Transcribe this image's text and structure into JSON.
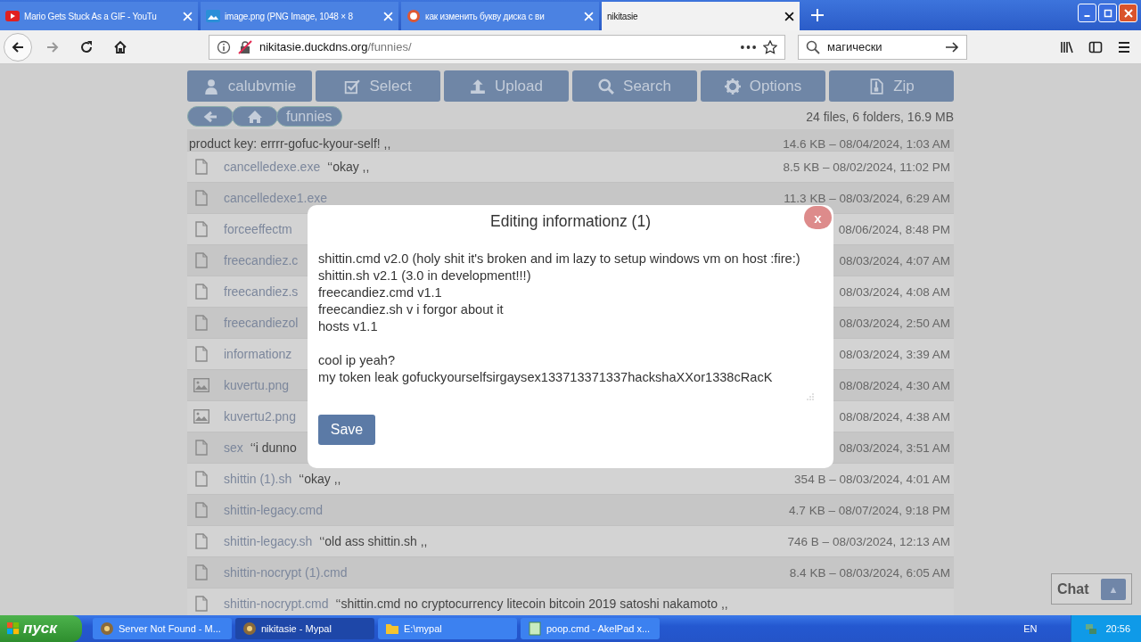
{
  "browser": {
    "tabs": [
      {
        "title": "Mario Gets Stuck As a GIF - YouTu",
        "kind": "video",
        "selected": false
      },
      {
        "title": "image.png (PNG Image, 1048 × 8",
        "kind": "image",
        "selected": false
      },
      {
        "title": "как изменить букву диска с ви",
        "kind": "search",
        "selected": false
      },
      {
        "title": "nikitasie",
        "kind": "plain",
        "selected": true
      }
    ],
    "url_host": "nikitasie.duckdns.org",
    "url_path": "/funnies/",
    "search_value": "магически"
  },
  "toolbar": [
    {
      "label": "calubvmie",
      "kind": "user"
    },
    {
      "label": "Select",
      "kind": "check"
    },
    {
      "label": "Upload",
      "kind": "upload"
    },
    {
      "label": "Search",
      "kind": "search"
    },
    {
      "label": "Options",
      "kind": "gear"
    },
    {
      "label": "Zip",
      "kind": "zip"
    }
  ],
  "breadcrumbs": [
    {
      "kind": "back"
    },
    {
      "kind": "home"
    },
    {
      "kind": "text",
      "label": "funnies"
    }
  ],
  "stats": "24 files, 6 folders, 16.9 MB",
  "files": [
    {
      "kind": "partial",
      "comment": "product key: errrr-gofuc-kyour-self! ,,",
      "meta": "14.6 KB – 08/04/2024, 1:03 AM"
    },
    {
      "kind": "file",
      "name": "cancelledexe.exe",
      "comment": "‘‘okay ,,",
      "meta": "8.5 KB – 08/02/2024, 11:02 PM"
    },
    {
      "kind": "file",
      "name": "cancelledexe1.exe",
      "meta": "11.3 KB – 08/03/2024, 6:29 AM"
    },
    {
      "kind": "file",
      "name": "forceeffectm",
      "meta": "08/06/2024, 8:48 PM"
    },
    {
      "kind": "file",
      "name": "freecandiez.c",
      "meta": "08/03/2024, 4:07 AM"
    },
    {
      "kind": "file",
      "name": "freecandiez.s",
      "meta": "08/03/2024, 4:08 AM"
    },
    {
      "kind": "file",
      "name": "freecandiezol",
      "meta": "08/03/2024, 2:50 AM"
    },
    {
      "kind": "file",
      "name": "informationz",
      "meta": "08/03/2024, 3:39 AM"
    },
    {
      "kind": "image",
      "name": "kuvertu.png",
      "meta": "08/08/2024, 4:30 AM"
    },
    {
      "kind": "image",
      "name": "kuvertu2.png",
      "meta": "08/08/2024, 4:38 AM"
    },
    {
      "kind": "file",
      "name": "sex",
      "comment": "‘‘i dunno",
      "meta": "08/03/2024, 3:51 AM"
    },
    {
      "kind": "file",
      "name": "shittin (1).sh",
      "comment": "‘‘okay ,,",
      "meta": "354 B – 08/03/2024, 4:01 AM"
    },
    {
      "kind": "file",
      "name": "shittin-legacy.cmd",
      "meta": "4.7 KB – 08/07/2024, 9:18 PM"
    },
    {
      "kind": "file",
      "name": "shittin-legacy.sh",
      "comment": "‘‘old ass shittin.sh ,,",
      "meta": "746 B – 08/03/2024, 12:13 AM"
    },
    {
      "kind": "file",
      "name": "shittin-nocrypt (1).cmd",
      "meta": "8.4 KB – 08/03/2024, 6:05 AM"
    },
    {
      "kind": "file",
      "name": "shittin-nocrypt.cmd",
      "comment": "‘‘shittin.cmd no cryptocurrency litecoin bitcoin 2019 satoshi nakamoto ,,"
    }
  ],
  "modal": {
    "title": "Editing informationz (1)",
    "close": "x",
    "value": "shittin.cmd v2.0 (holy shit it's broken and im lazy to setup windows vm on host :fire:)\nshittin.sh v2.1 (3.0 in development!!!)\nfreecandiez.cmd v1.1\nfreecandiez.sh v i forgor about it\nhosts v1.1\n\ncool ip yeah?\nmy token leak gofuckyourselfsirgaysex133713371337hackshaXXor1338cRacK",
    "save": "Save"
  },
  "chat": {
    "label": "Chat",
    "arrow": "▲"
  },
  "taskbar": {
    "start": "пуск",
    "tasks": [
      {
        "label": "Server Not Found - M...",
        "kind": "browser",
        "selected": false
      },
      {
        "label": "nikitasie - Mypal",
        "kind": "browser",
        "selected": true
      },
      {
        "label": "E:\\mypal",
        "kind": "folder",
        "selected": false
      },
      {
        "label": "poop.cmd - AkelPad x...",
        "kind": "notepad",
        "selected": false
      }
    ],
    "lang": "EN",
    "time": "20:56"
  }
}
